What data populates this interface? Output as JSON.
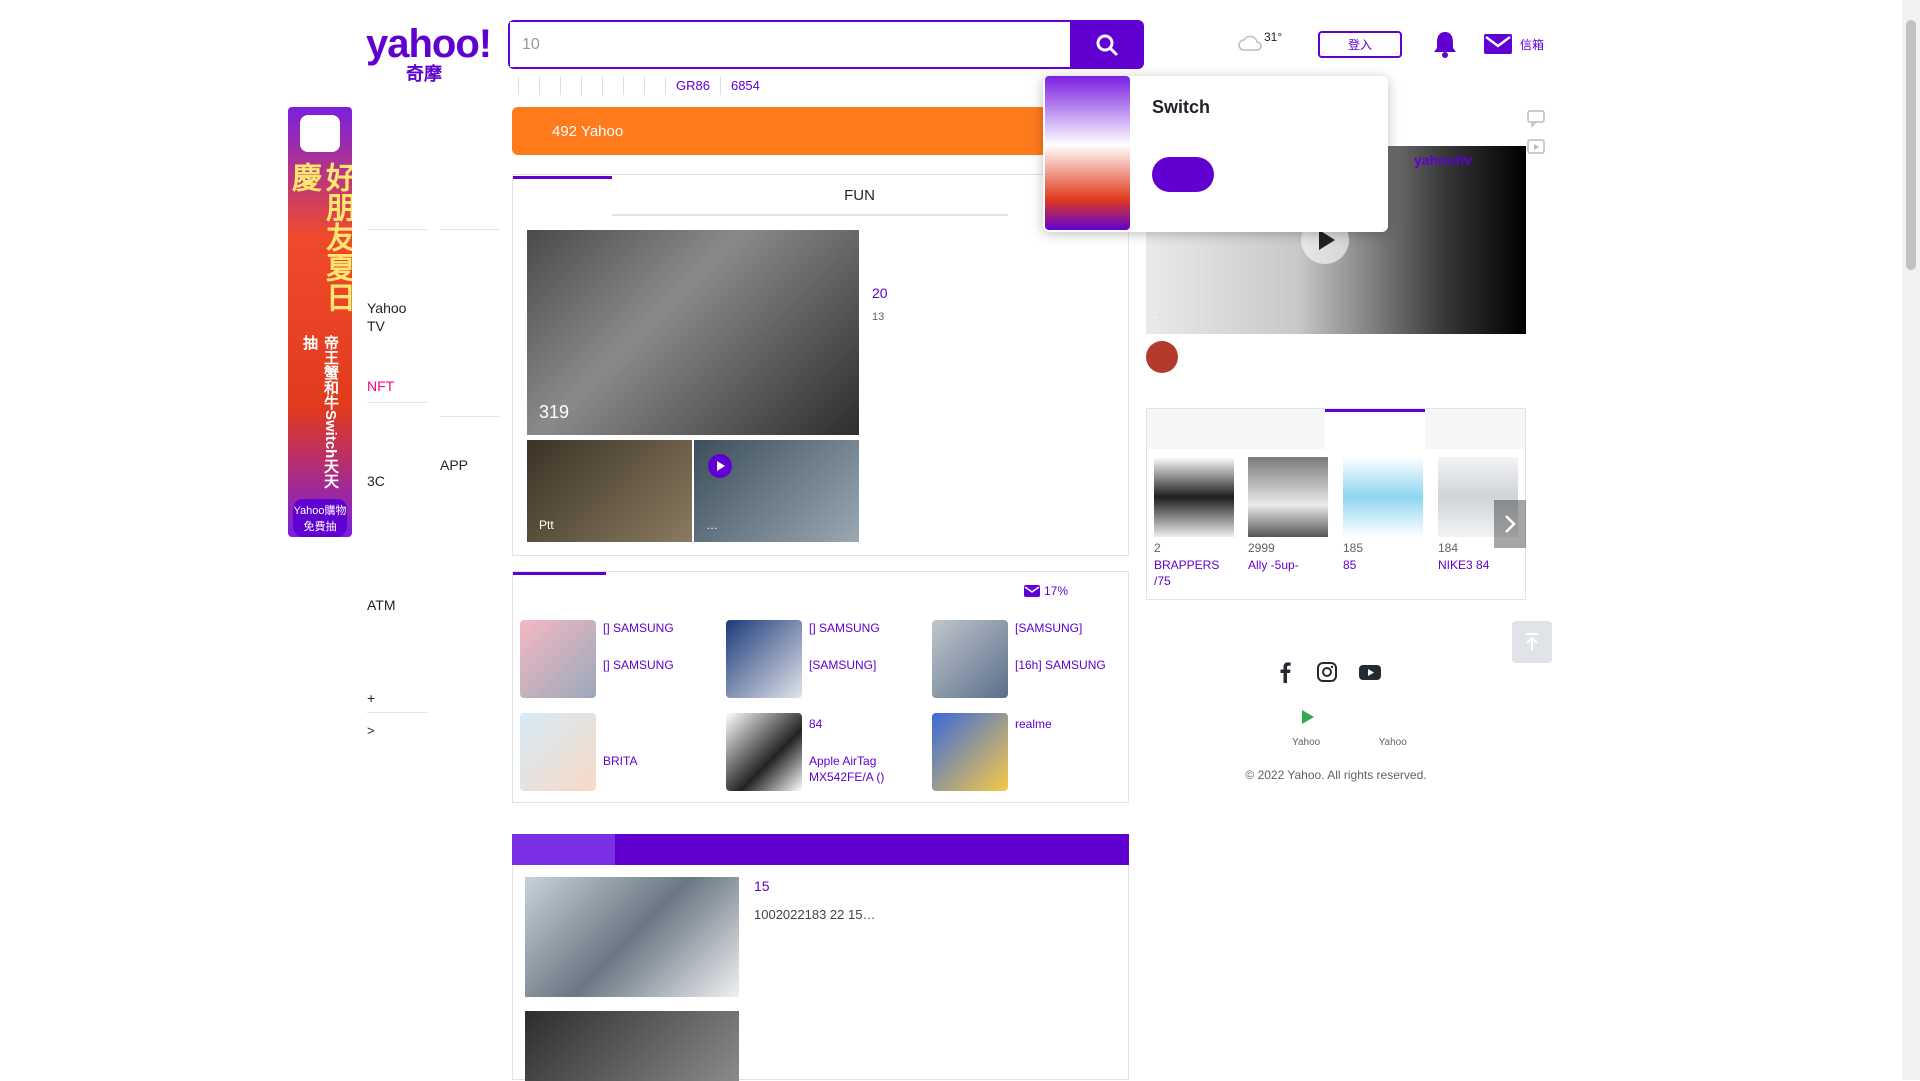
{
  "header": {
    "logo_text": "yahoo!",
    "logo_sub": "奇摩",
    "search_value": "10",
    "weather_temp": "31°",
    "login_label": "登入",
    "mail_label": "信箱"
  },
  "trending": [
    "",
    "",
    "",
    "",
    "",
    "",
    "",
    "",
    "GR86",
    "6854"
  ],
  "left_ad": {
    "headline": "好朋友夏日慶",
    "sub": "帝王蟹和牛Switch天天抽",
    "cta": "Yahoo購物免費抽"
  },
  "nav_col1": [
    "",
    "",
    "",
    "",
    "",
    "",
    "Yahoo TV",
    "",
    "NFT",
    "",
    "",
    "3C",
    "",
    "",
    "",
    "ATM",
    "",
    "",
    "+",
    " >"
  ],
  "nav_col2": [
    "",
    "",
    "",
    "",
    "",
    "",
    "",
    "",
    "",
    "",
    "APP",
    "",
    "",
    "",
    "",
    "",
    ""
  ],
  "promo": {
    "left": "",
    "text": "492 Yahoo"
  },
  "news_tabs": [
    "",
    "",
    "",
    "FUN",
    ""
  ],
  "hero": {
    "caption": "319"
  },
  "thumbs": [
    "Ptt",
    "…"
  ],
  "headlines": [
    {
      "title": "",
      "sub": ""
    },
    {
      "title": "20",
      "sub": "13"
    },
    {
      "title": " ",
      "sub": ""
    },
    {
      "title": "",
      "sub": ""
    },
    {
      "title": " ",
      "sub": ""
    }
  ],
  "shop_tabs": [
    "",
    "",
    "",
    ""
  ],
  "shop_rebate": " 17%",
  "products": [
    {
      "line1": "[] SAMSUNG",
      "line2": "[] SAMSUNG"
    },
    {
      "line1": "[] SAMSUNG",
      "line2": "[SAMSUNG] "
    },
    {
      "line1": "[SAMSUNG] ",
      "line2": "[16h] SAMSUNG"
    },
    {
      "line1": " ",
      "line2": "BRITA "
    },
    {
      "line1": " 84",
      "line2": "Apple AirTag MX542FE/A ()"
    },
    {
      "line1": "realme ",
      "line2": " "
    }
  ],
  "lower_tabs": [
    "",
    "",
    "",
    "",
    "",
    ""
  ],
  "stories": [
    {
      "title": " 15",
      "body": "1002022183 22 15…",
      "meta": ""
    },
    {
      "title": "  ",
      "body": "",
      "meta": ""
    }
  ],
  "popup": {
    "title": "Switch",
    "desc": "",
    "cta": "",
    "later": ""
  },
  "video": {
    "caption": "",
    "sub": "．",
    "sub2": "",
    "title": ""
  },
  "trend_tabs": [
    "",
    "",
    ""
  ],
  "trend_items": [
    {
      "price": "2",
      "name": "BRAPPERS /75"
    },
    {
      "price": "2999",
      "name": "Ally -5up-"
    },
    {
      "price": "185",
      "name": " 85"
    },
    {
      "price": "184",
      "name": "NIKE3 84"
    }
  ],
  "footer_links1": [
    "",
    "",
    "",
    "",
    "",
    ""
  ],
  "footer_links2": [
    "",
    "",
    "Yahoo",
    "Yahoo"
  ],
  "copyright": "© 2022 Yahoo. All rights reserved."
}
